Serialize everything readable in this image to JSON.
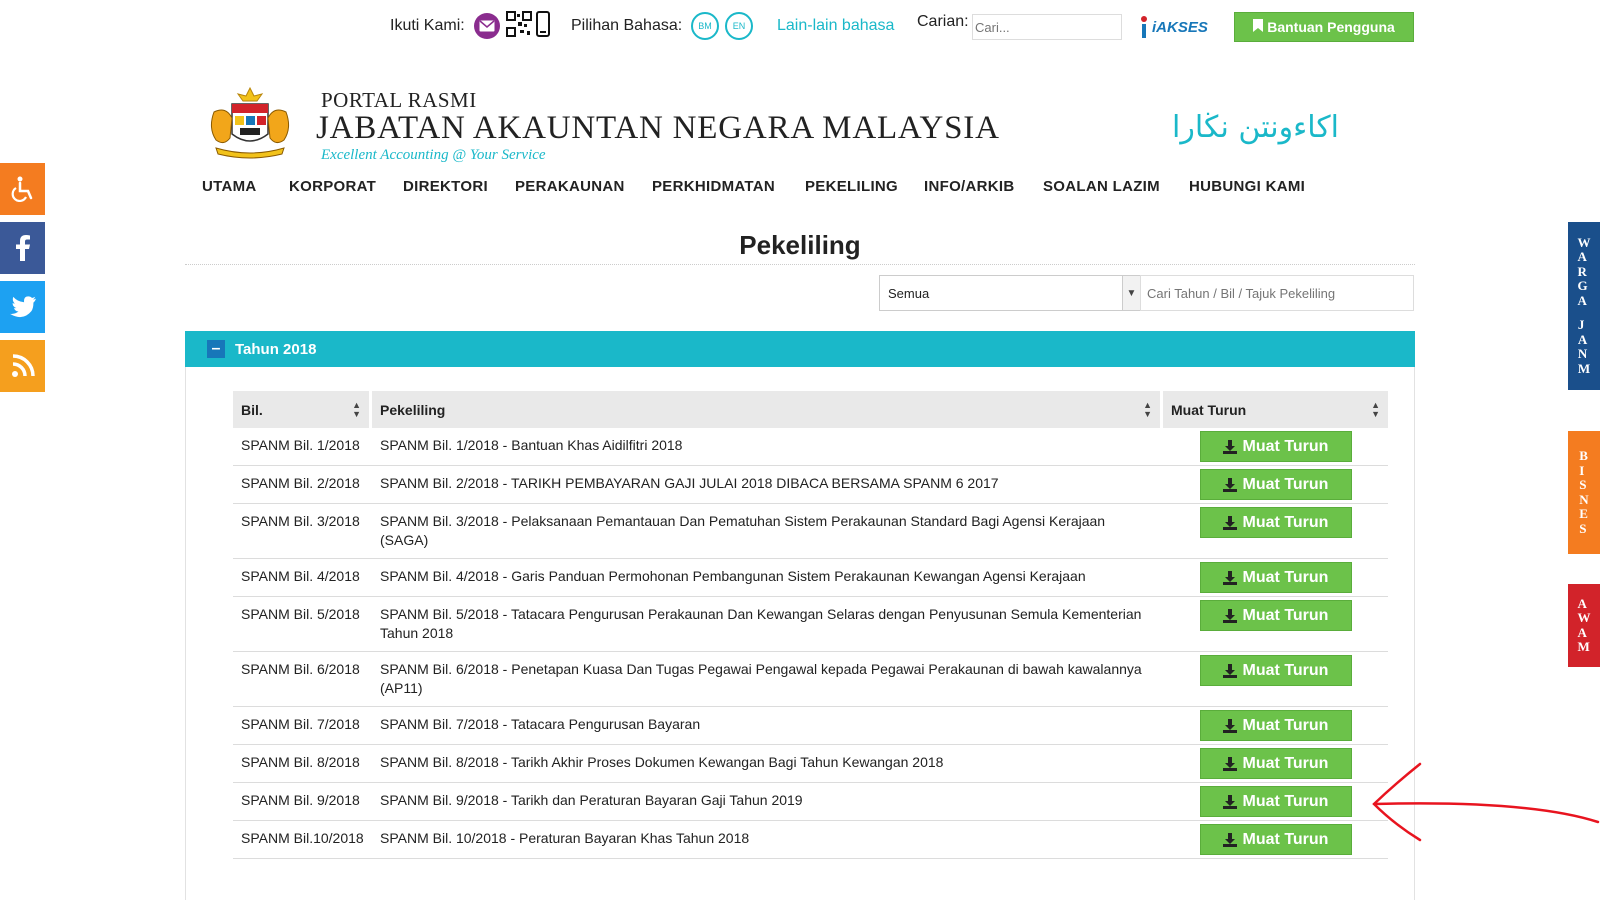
{
  "topbar": {
    "follow_label": "Ikuti Kami:",
    "language_label": "Pilihan Bahasa:",
    "lang_bm": "BM",
    "lang_en": "EN",
    "other_languages": "Lain-lain bahasa",
    "search_label": "Carian:",
    "search_placeholder": "Cari...",
    "akses_logo": "iAKSES",
    "help_button": "Bantuan Pengguna"
  },
  "header": {
    "pre_title": "PORTAL RASMI",
    "title": "JABATAN AKAUNTAN NEGARA MALAYSIA",
    "slogan": "Excellent Accounting @ Your Service",
    "jawi": "اكاءونتن نڬارا"
  },
  "nav": [
    "UTAMA",
    "KORPORAT",
    "DIREKTORI",
    "PERAKAUNAN",
    "PERKHIDMATAN",
    "PEKELILING",
    "INFO/ARKIB",
    "SOALAN LAZIM",
    "HUBUNGI KAMI"
  ],
  "page": {
    "title": "Pekeliling",
    "filter_selected": "Semua",
    "filter_placeholder": "Cari Tahun / Bil / Tajuk Pekeliling",
    "year_label": "Tahun 2018"
  },
  "table": {
    "headers": [
      "Bil.",
      "Pekeliling",
      "Muat Turun"
    ],
    "download_label": "Muat Turun",
    "rows": [
      {
        "bil": "SPANM Bil. 1/2018",
        "title": "SPANM Bil. 1/2018 - Bantuan Khas Aidilfitri 2018"
      },
      {
        "bil": "SPANM Bil. 2/2018",
        "title": "SPANM Bil. 2/2018 - TARIKH PEMBAYARAN GAJI JULAI 2018 DIBACA BERSAMA SPANM 6 2017"
      },
      {
        "bil": "SPANM Bil. 3/2018",
        "title": "SPANM Bil. 3/2018 - Pelaksanaan Pemantauan Dan Pematuhan Sistem Perakaunan Standard Bagi Agensi Kerajaan (SAGA)"
      },
      {
        "bil": "SPANM Bil. 4/2018",
        "title": "SPANM Bil. 4/2018 - Garis Panduan Permohonan Pembangunan Sistem Perakaunan Kewangan Agensi Kerajaan"
      },
      {
        "bil": "SPANM Bil. 5/2018",
        "title": "SPANM Bil. 5/2018 - Tatacara Pengurusan Perakaunan Dan Kewangan Selaras dengan Penyusunan Semula Kementerian Tahun 2018"
      },
      {
        "bil": "SPANM Bil. 6/2018",
        "title": "SPANM Bil. 6/2018 - Penetapan Kuasa Dan Tugas Pegawai Pengawal kepada Pegawai Perakaunan di bawah kawalannya (AP11)"
      },
      {
        "bil": "SPANM Bil. 7/2018",
        "title": "SPANM Bil. 7/2018 - Tatacara Pengurusan Bayaran"
      },
      {
        "bil": "SPANM Bil. 8/2018",
        "title": "SPANM Bil. 8/2018 - Tarikh Akhir Proses Dokumen Kewangan Bagi Tahun Kewangan 2018"
      },
      {
        "bil": "SPANM Bil. 9/2018",
        "title": "SPANM Bil. 9/2018 - Tarikh dan Peraturan Bayaran Gaji Tahun 2019"
      },
      {
        "bil": "SPANM Bil.10/2018",
        "title": "SPANM Bil. 10/2018 - Peraturan Bayaran Khas Tahun 2018"
      }
    ]
  },
  "side_tabs": {
    "warga": "WARGA",
    "jam": "JANM",
    "bisnes": "BISNES",
    "awam": "AWAM"
  },
  "colors": {
    "accent": "#1ab8c9",
    "button_green": "#6cc24a",
    "nav_blue": "#1777b9",
    "orange": "#f47c20",
    "red": "#d2232a"
  }
}
